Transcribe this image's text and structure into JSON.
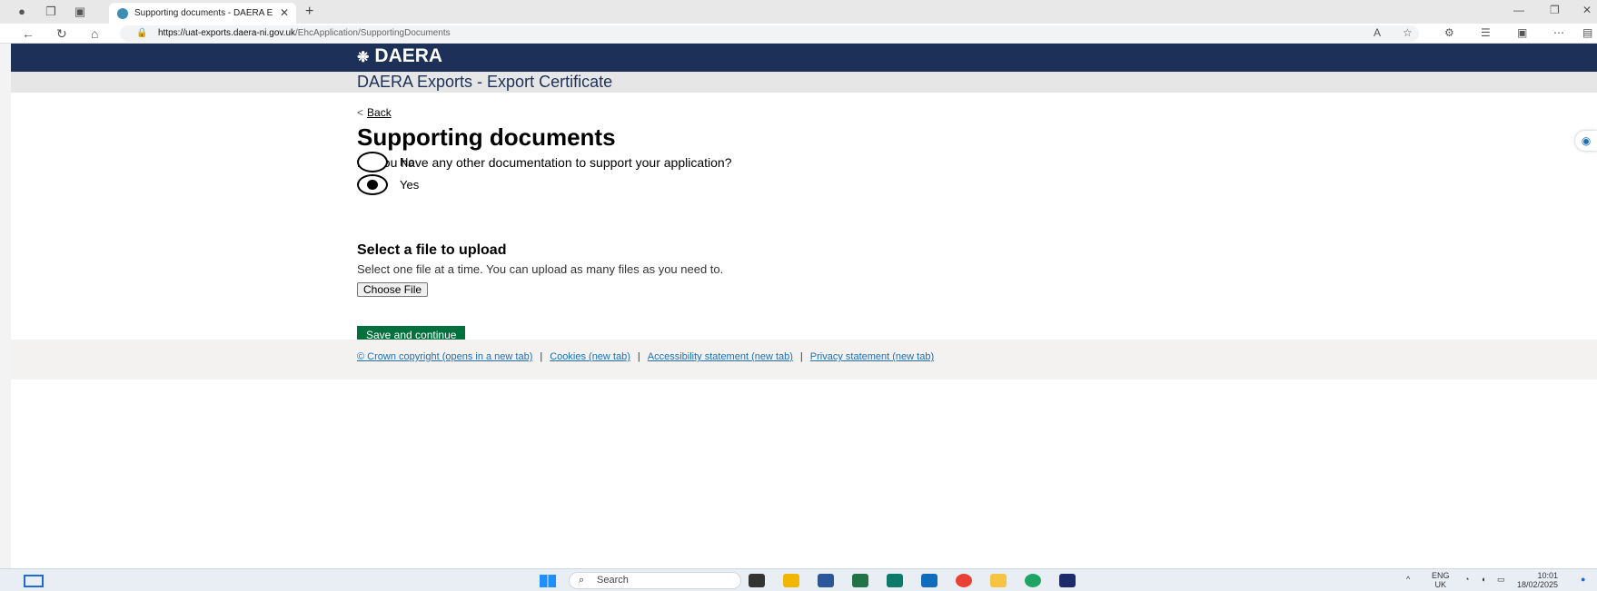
{
  "browser": {
    "tab_title": "Supporting documents - DAERA E",
    "url_host": "https://uat-exports.daera-ni.gov.uk",
    "url_path": "/EhcApplication/SupportingDocuments"
  },
  "header": {
    "logo_text": "DAERA",
    "service_name": "DAERA Exports - Export Certificate"
  },
  "page": {
    "back_label": "Back",
    "title": "Supporting documents",
    "question": "Do you have any other documentation to support your application?",
    "options": [
      {
        "label": "No",
        "checked": false
      },
      {
        "label": "Yes",
        "checked": true
      }
    ],
    "upload_heading": "Select a file to upload",
    "upload_hint": "Select one file at a time. You can upload as many files as you need to.",
    "choose_file_label": "Choose File",
    "save_label": "Save and continue"
  },
  "footer": {
    "links": [
      "© Crown copyright (opens in a new tab)",
      "Cookies (new tab)",
      "Accessibility statement (new tab)",
      "Privacy statement (new tab)"
    ]
  },
  "taskbar": {
    "search_placeholder": "Search",
    "lang": "ENG",
    "region": "UK",
    "time": "10:01",
    "date": "18/02/2025"
  },
  "colors": {
    "header_bg": "#1d3158",
    "save_button": "#00703c",
    "link": "#1d70b8"
  }
}
